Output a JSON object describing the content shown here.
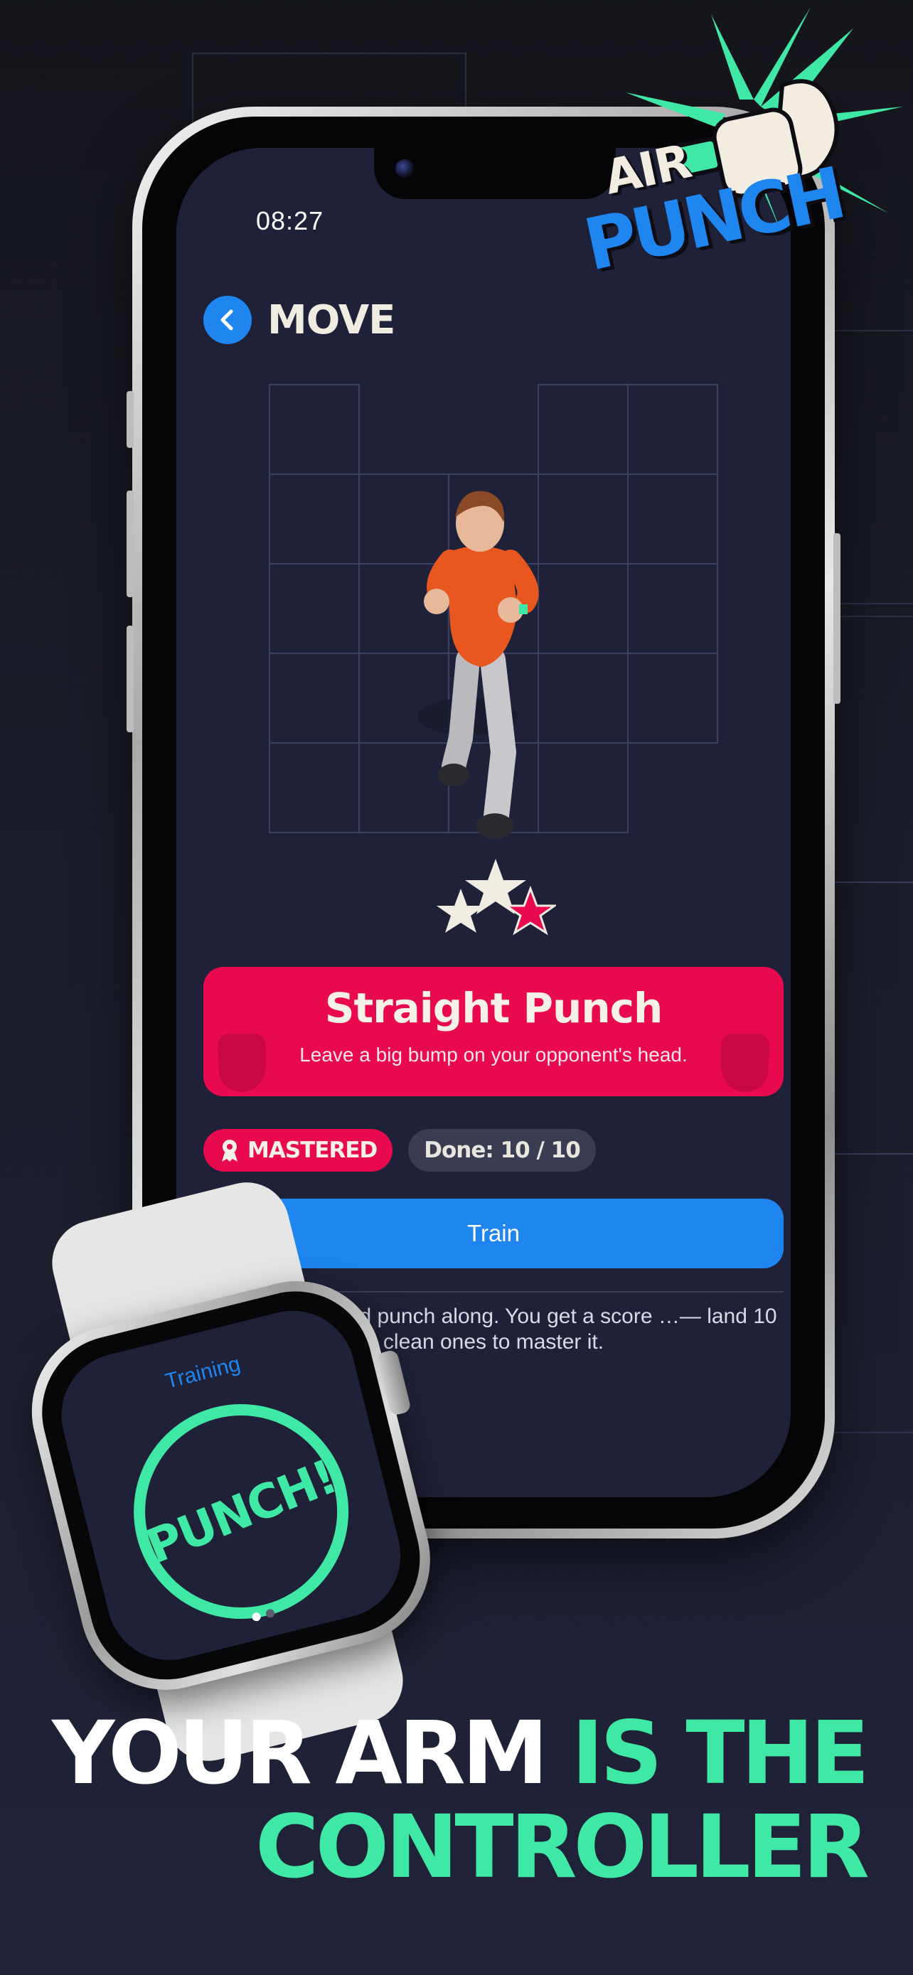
{
  "status_bar": {
    "time": "08:27"
  },
  "header": {
    "title": "MOVE"
  },
  "move_card": {
    "title": "Straight Punch",
    "subtitle": "Leave a big bump on your opponent's head.",
    "stars_earned": 3
  },
  "badges": {
    "mastered": "MASTERED",
    "done": "Done: 10 / 10"
  },
  "train_button": {
    "label": "Train"
  },
  "hint": {
    "text": "…ove above and punch along. You get a score …— land 10 clean ones to master it."
  },
  "watch": {
    "title": "Training",
    "action": "PUNCH!",
    "page_index": 1,
    "page_count": 2
  },
  "logo": {
    "line1": "AIR",
    "line2": "PUNCH"
  },
  "headline": {
    "part1": "YOUR ARM ",
    "part2": "IS THE",
    "part3": "CONTROLLER"
  },
  "colors": {
    "accent_green": "#3fe9a5",
    "accent_blue": "#1f86f0",
    "accent_pink": "#e8094f",
    "screen_bg": "#1f2138"
  },
  "icons": [
    "back-chevron-icon",
    "fist-icon",
    "star-icon",
    "award-ribbon-icon",
    "air-punch-logo"
  ]
}
